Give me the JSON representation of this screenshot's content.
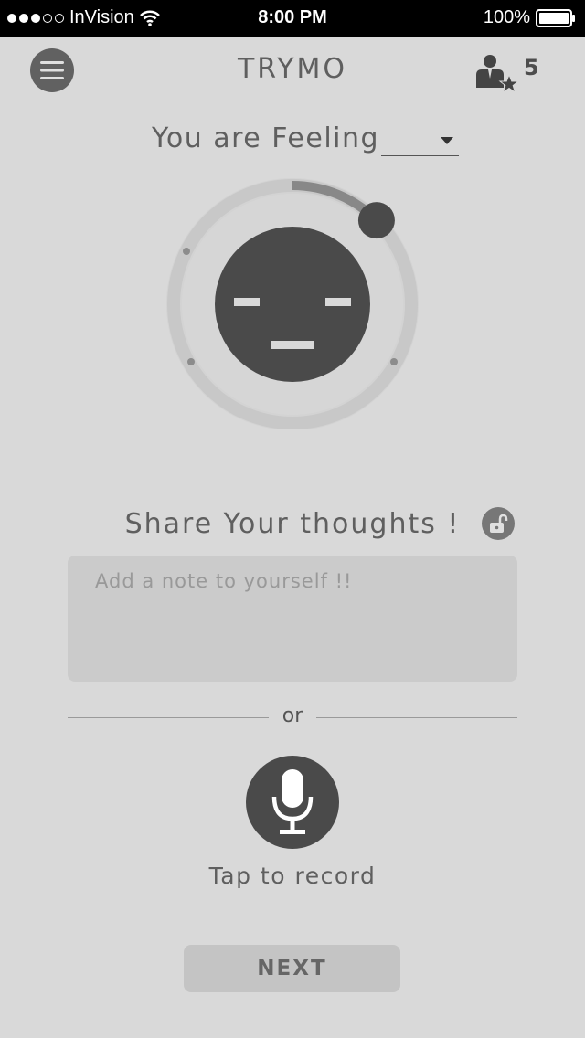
{
  "status_bar": {
    "carrier": "InVision",
    "time": "8:00 PM",
    "battery": "100%",
    "signal_dots_filled": 3,
    "signal_dots_total": 5
  },
  "header": {
    "title": "TRYMO",
    "menu_icon": "hamburger-menu-icon",
    "friends_icon": "user-star-icon",
    "friends_count": "5"
  },
  "feeling": {
    "label": "You are Feeling",
    "selected_value": ""
  },
  "mood_dial": {
    "face_icon": "neutral-face-icon",
    "level": 0.125
  },
  "share": {
    "title": "Share Your thoughts !",
    "lock_icon": "unlock-icon",
    "note_placeholder": "Add a note to yourself !!",
    "note_value": ""
  },
  "divider": {
    "text": "or"
  },
  "record": {
    "icon": "microphone-icon",
    "label": "Tap to record"
  },
  "next_button": {
    "label": "NEXT"
  },
  "colors": {
    "background": "#d9d9d9",
    "dark": "#4a4a4a",
    "text": "#5f5f5f"
  }
}
